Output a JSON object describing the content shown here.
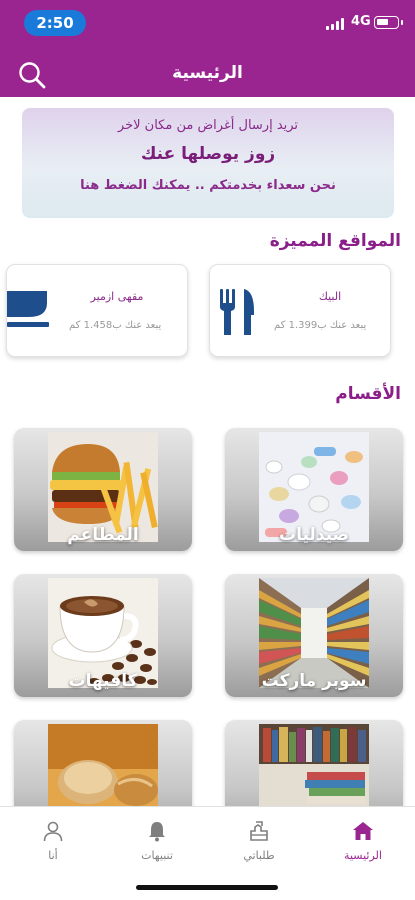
{
  "status_bar": {
    "time": "2:50",
    "network": "4G",
    "battery_level": 0.6
  },
  "header": {
    "title": "الرئيسية",
    "search_icon": "search-icon"
  },
  "banner": {
    "line1": "تريد إرسال أغراض من مكان لاخر",
    "line2": "زوز يوصلها عنك",
    "line3": "نحن سعداء بخدمتكم .. يمكنك الضغط هنا"
  },
  "featured": {
    "title": "المواقع المميزة",
    "items": [
      {
        "name": "البيك",
        "distance": "يبعد عنك ب1.399 كم",
        "icon": "restaurant-icon"
      },
      {
        "name": "مقهى ازمير",
        "distance": "يبعد عنك ب1.458 كم",
        "icon": "cafe-icon"
      }
    ]
  },
  "categories": {
    "title": "الأقسام",
    "items": [
      {
        "label": "صيدليات",
        "image": "pharmacy-image"
      },
      {
        "label": "المطاعم",
        "image": "restaurant-image"
      },
      {
        "label": "سوبر ماركت",
        "image": "supermarket-image"
      },
      {
        "label": "كافيهات",
        "image": "cafe-image"
      },
      {
        "label": "",
        "image": "bookstore-image"
      },
      {
        "label": "",
        "image": "bakery-image"
      }
    ]
  },
  "tabbar": {
    "items": [
      {
        "label": "الرئيسية",
        "icon": "home-icon",
        "active": true
      },
      {
        "label": "طلباتي",
        "icon": "orders-icon",
        "active": false
      },
      {
        "label": "تنبيهات",
        "icon": "bell-icon",
        "active": false
      },
      {
        "label": "أنا",
        "icon": "user-icon",
        "active": false
      }
    ]
  },
  "colors": {
    "brand": "#9b2590",
    "accent_text": "#8a1f8a",
    "status_pill": "#1a7ad9",
    "icon_blue": "#1f4e8c"
  }
}
